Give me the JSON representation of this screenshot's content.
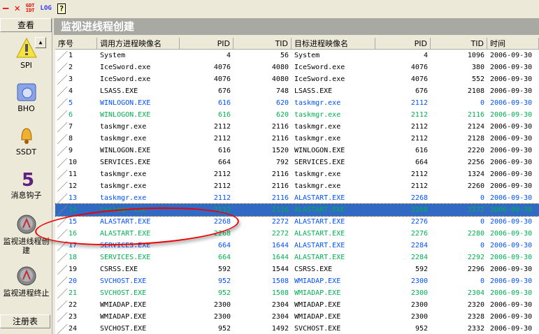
{
  "toolbar": {
    "minimize": "—",
    "close": "✕",
    "gdt": "GDT",
    "idt": "IDT",
    "log": "LOG",
    "help": "?"
  },
  "sidebar": {
    "header": "查看",
    "items": [
      {
        "label": "SPI"
      },
      {
        "label": "BHO"
      },
      {
        "label": "SSDT"
      },
      {
        "label": "消息钩子"
      },
      {
        "label": "监视进线程创建"
      },
      {
        "label": "监视进程终止"
      }
    ],
    "registry": "注册表"
  },
  "title": "监视进线程创建",
  "columns": [
    "序号",
    "调用方进程映像名",
    "PID",
    "TID",
    "目标进程映像名",
    "PID",
    "TID",
    "时间"
  ],
  "colors": {
    "blue": "#0050ff",
    "green": "#00b050",
    "selection": "#316AC5"
  },
  "rows": [
    {
      "n": "1",
      "caller": "System",
      "pid": "4",
      "tid": "56",
      "target": "System",
      "tpid": "4",
      "ttid": "1096",
      "time": "2006-09-30",
      "color": "black"
    },
    {
      "n": "2",
      "caller": "IceSword.exe",
      "pid": "4076",
      "tid": "4080",
      "target": "IceSword.exe",
      "tpid": "4076",
      "ttid": "380",
      "time": "2006-09-30",
      "color": "black"
    },
    {
      "n": "3",
      "caller": "IceSword.exe",
      "pid": "4076",
      "tid": "4080",
      "target": "IceSword.exe",
      "tpid": "4076",
      "ttid": "552",
      "time": "2006-09-30",
      "color": "black"
    },
    {
      "n": "4",
      "caller": "LSASS.EXE",
      "pid": "676",
      "tid": "748",
      "target": "LSASS.EXE",
      "tpid": "676",
      "ttid": "2108",
      "time": "2006-09-30",
      "color": "black"
    },
    {
      "n": "5",
      "caller": "WINLOGON.EXE",
      "pid": "616",
      "tid": "620",
      "target": "taskmgr.exe",
      "tpid": "2112",
      "ttid": "0",
      "time": "2006-09-30",
      "color": "blue"
    },
    {
      "n": "6",
      "caller": "WINLOGON.EXE",
      "pid": "616",
      "tid": "620",
      "target": "taskmgr.exe",
      "tpid": "2112",
      "ttid": "2116",
      "time": "2006-09-30",
      "color": "green"
    },
    {
      "n": "7",
      "caller": "taskmgr.exe",
      "pid": "2112",
      "tid": "2116",
      "target": "taskmgr.exe",
      "tpid": "2112",
      "ttid": "2124",
      "time": "2006-09-30",
      "color": "black"
    },
    {
      "n": "8",
      "caller": "taskmgr.exe",
      "pid": "2112",
      "tid": "2116",
      "target": "taskmgr.exe",
      "tpid": "2112",
      "ttid": "2128",
      "time": "2006-09-30",
      "color": "black"
    },
    {
      "n": "9",
      "caller": "WINLOGON.EXE",
      "pid": "616",
      "tid": "1520",
      "target": "WINLOGON.EXE",
      "tpid": "616",
      "ttid": "2220",
      "time": "2006-09-30",
      "color": "black"
    },
    {
      "n": "10",
      "caller": "SERVICES.EXE",
      "pid": "664",
      "tid": "792",
      "target": "SERVICES.EXE",
      "tpid": "664",
      "ttid": "2256",
      "time": "2006-09-30",
      "color": "black"
    },
    {
      "n": "11",
      "caller": "taskmgr.exe",
      "pid": "2112",
      "tid": "2116",
      "target": "taskmgr.exe",
      "tpid": "2112",
      "ttid": "1324",
      "time": "2006-09-30",
      "color": "black"
    },
    {
      "n": "12",
      "caller": "taskmgr.exe",
      "pid": "2112",
      "tid": "2116",
      "target": "taskmgr.exe",
      "tpid": "2112",
      "ttid": "2260",
      "time": "2006-09-30",
      "color": "black"
    },
    {
      "n": "13",
      "caller": "taskmgr.exe",
      "pid": "2112",
      "tid": "2116",
      "target": "ALASTART.EXE",
      "tpid": "2268",
      "ttid": "0",
      "time": "2006-09-30",
      "color": "blue"
    },
    {
      "n": "14",
      "caller": "taskmgr.exe",
      "pid": "2112",
      "tid": "2116",
      "target": "ALASTART.EXE",
      "tpid": "2268",
      "ttid": "2272",
      "time": "2006-09-30",
      "color": "green",
      "selected": true
    },
    {
      "n": "15",
      "caller": "ALASTART.EXE",
      "pid": "2268",
      "tid": "2272",
      "target": "ALASTART.EXE",
      "tpid": "2276",
      "ttid": "0",
      "time": "2006-09-30",
      "color": "blue"
    },
    {
      "n": "16",
      "caller": "ALASTART.EXE",
      "pid": "2268",
      "tid": "2272",
      "target": "ALASTART.EXE",
      "tpid": "2276",
      "ttid": "2280",
      "time": "2006-09-30",
      "color": "green"
    },
    {
      "n": "17",
      "caller": "SERVICES.EXE",
      "pid": "664",
      "tid": "1644",
      "target": "ALASTART.EXE",
      "tpid": "2284",
      "ttid": "0",
      "time": "2006-09-30",
      "color": "blue"
    },
    {
      "n": "18",
      "caller": "SERVICES.EXE",
      "pid": "664",
      "tid": "1644",
      "target": "ALASTART.EXE",
      "tpid": "2284",
      "ttid": "2292",
      "time": "2006-09-30",
      "color": "green"
    },
    {
      "n": "19",
      "caller": "CSRSS.EXE",
      "pid": "592",
      "tid": "1544",
      "target": "CSRSS.EXE",
      "tpid": "592",
      "ttid": "2296",
      "time": "2006-09-30",
      "color": "black"
    },
    {
      "n": "20",
      "caller": "SVCHOST.EXE",
      "pid": "952",
      "tid": "1508",
      "target": "WMIADAP.EXE",
      "tpid": "2300",
      "ttid": "0",
      "time": "2006-09-30",
      "color": "blue"
    },
    {
      "n": "21",
      "caller": "SVCHOST.EXE",
      "pid": "952",
      "tid": "1508",
      "target": "WMIADAP.EXE",
      "tpid": "2300",
      "ttid": "2304",
      "time": "2006-09-30",
      "color": "green"
    },
    {
      "n": "22",
      "caller": "WMIADAP.EXE",
      "pid": "2300",
      "tid": "2304",
      "target": "WMIADAP.EXE",
      "tpid": "2300",
      "ttid": "2320",
      "time": "2006-09-30",
      "color": "black"
    },
    {
      "n": "23",
      "caller": "WMIADAP.EXE",
      "pid": "2300",
      "tid": "2304",
      "target": "WMIADAP.EXE",
      "tpid": "2300",
      "ttid": "2328",
      "time": "2006-09-30",
      "color": "black"
    },
    {
      "n": "24",
      "caller": "SVCHOST.EXE",
      "pid": "952",
      "tid": "1492",
      "target": "SVCHOST.EXE",
      "tpid": "952",
      "ttid": "2332",
      "time": "2006-09-30",
      "color": "black"
    }
  ]
}
